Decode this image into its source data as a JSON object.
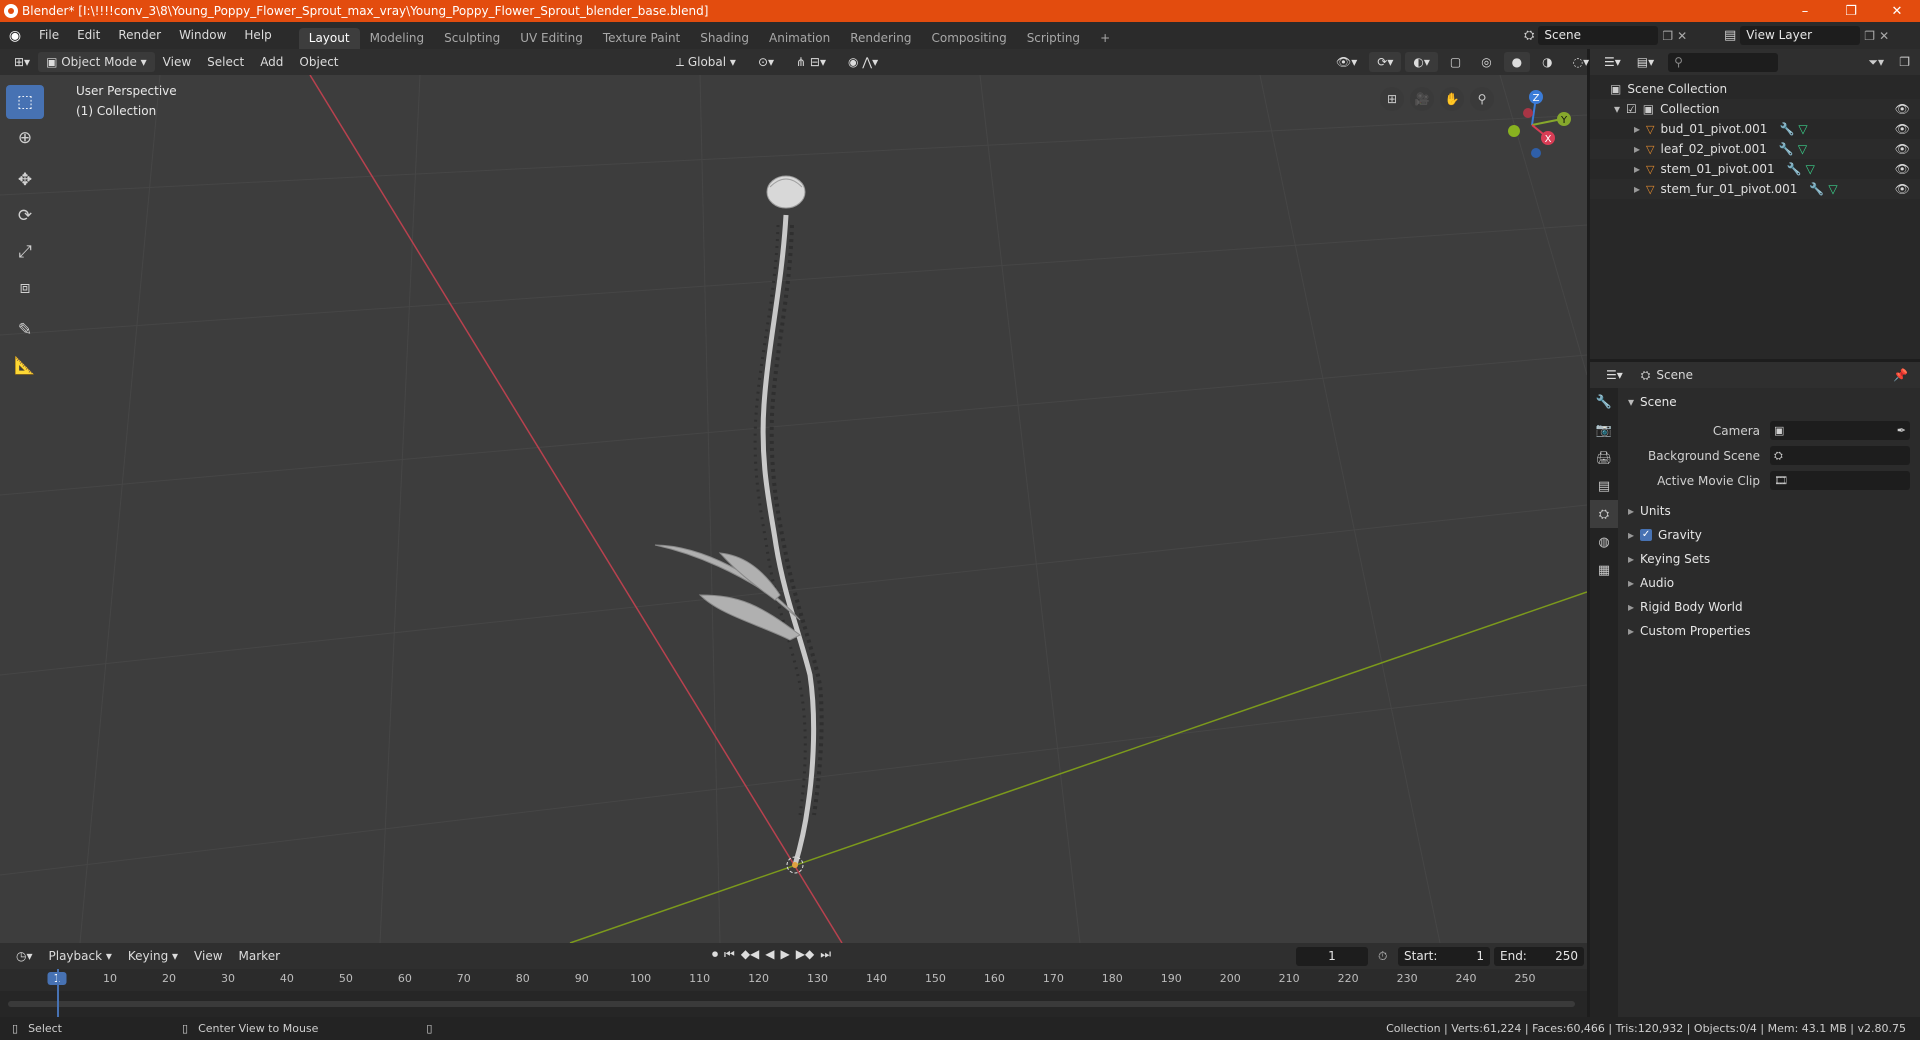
{
  "window": {
    "title": "Blender* [I:\\!!!!conv_3\\8\\Young_Poppy_Flower_Sprout_max_vray\\Young_Poppy_Flower_Sprout_blender_base.blend]",
    "minimize": "–",
    "restore": "❐",
    "close": "✕"
  },
  "menubar": {
    "items": [
      "File",
      "Edit",
      "Render",
      "Window",
      "Help"
    ],
    "workspaces": [
      "Layout",
      "Modeling",
      "Sculpting",
      "UV Editing",
      "Texture Paint",
      "Shading",
      "Animation",
      "Rendering",
      "Compositing",
      "Scripting"
    ],
    "add_tab": "+",
    "scene": "Scene",
    "view_layer": "View Layer"
  },
  "viewport_header": {
    "mode": "Object Mode",
    "menus": [
      "View",
      "Select",
      "Add",
      "Object"
    ],
    "orientation": "Global"
  },
  "viewport": {
    "perspective": "User Perspective",
    "collection": "(1) Collection",
    "gizmo": {
      "z": "Z",
      "y": "Y",
      "x": "X"
    }
  },
  "outliner": {
    "root": "Scene Collection",
    "collection": "Collection",
    "objects": [
      "bud_01_pivot.001",
      "leaf_02_pivot.001",
      "stem_01_pivot.001",
      "stem_fur_01_pivot.001"
    ]
  },
  "properties": {
    "context": "Scene",
    "panel": "Scene",
    "fields": [
      {
        "label": "Camera"
      },
      {
        "label": "Background Scene"
      },
      {
        "label": "Active Movie Clip"
      }
    ],
    "subpanels": [
      "Units",
      "Gravity",
      "Keying Sets",
      "Audio",
      "Rigid Body World",
      "Custom Properties"
    ]
  },
  "timeline": {
    "menus": [
      "Playback",
      "Keying",
      "View",
      "Marker"
    ],
    "current_frame": "1",
    "start_label": "Start:",
    "start": "1",
    "end_label": "End:",
    "end": "250",
    "ruler": [
      "1",
      "10",
      "20",
      "30",
      "40",
      "50",
      "60",
      "70",
      "80",
      "90",
      "100",
      "110",
      "120",
      "130",
      "140",
      "150",
      "160",
      "170",
      "180",
      "190",
      "200",
      "210",
      "220",
      "230",
      "240",
      "250"
    ]
  },
  "statusbar": {
    "left1": "Select",
    "left2": "Center View to Mouse",
    "stats": "Collection | Verts:61,224 | Faces:60,466 | Tris:120,932 | Objects:0/4 | Mem: 43.1 MB | v2.80.75"
  },
  "colors": {
    "titlebar": "#e34c0e",
    "active_tool": "#4772b3",
    "x_axis": "#c0394b",
    "y_axis": "#7c9a1c"
  }
}
